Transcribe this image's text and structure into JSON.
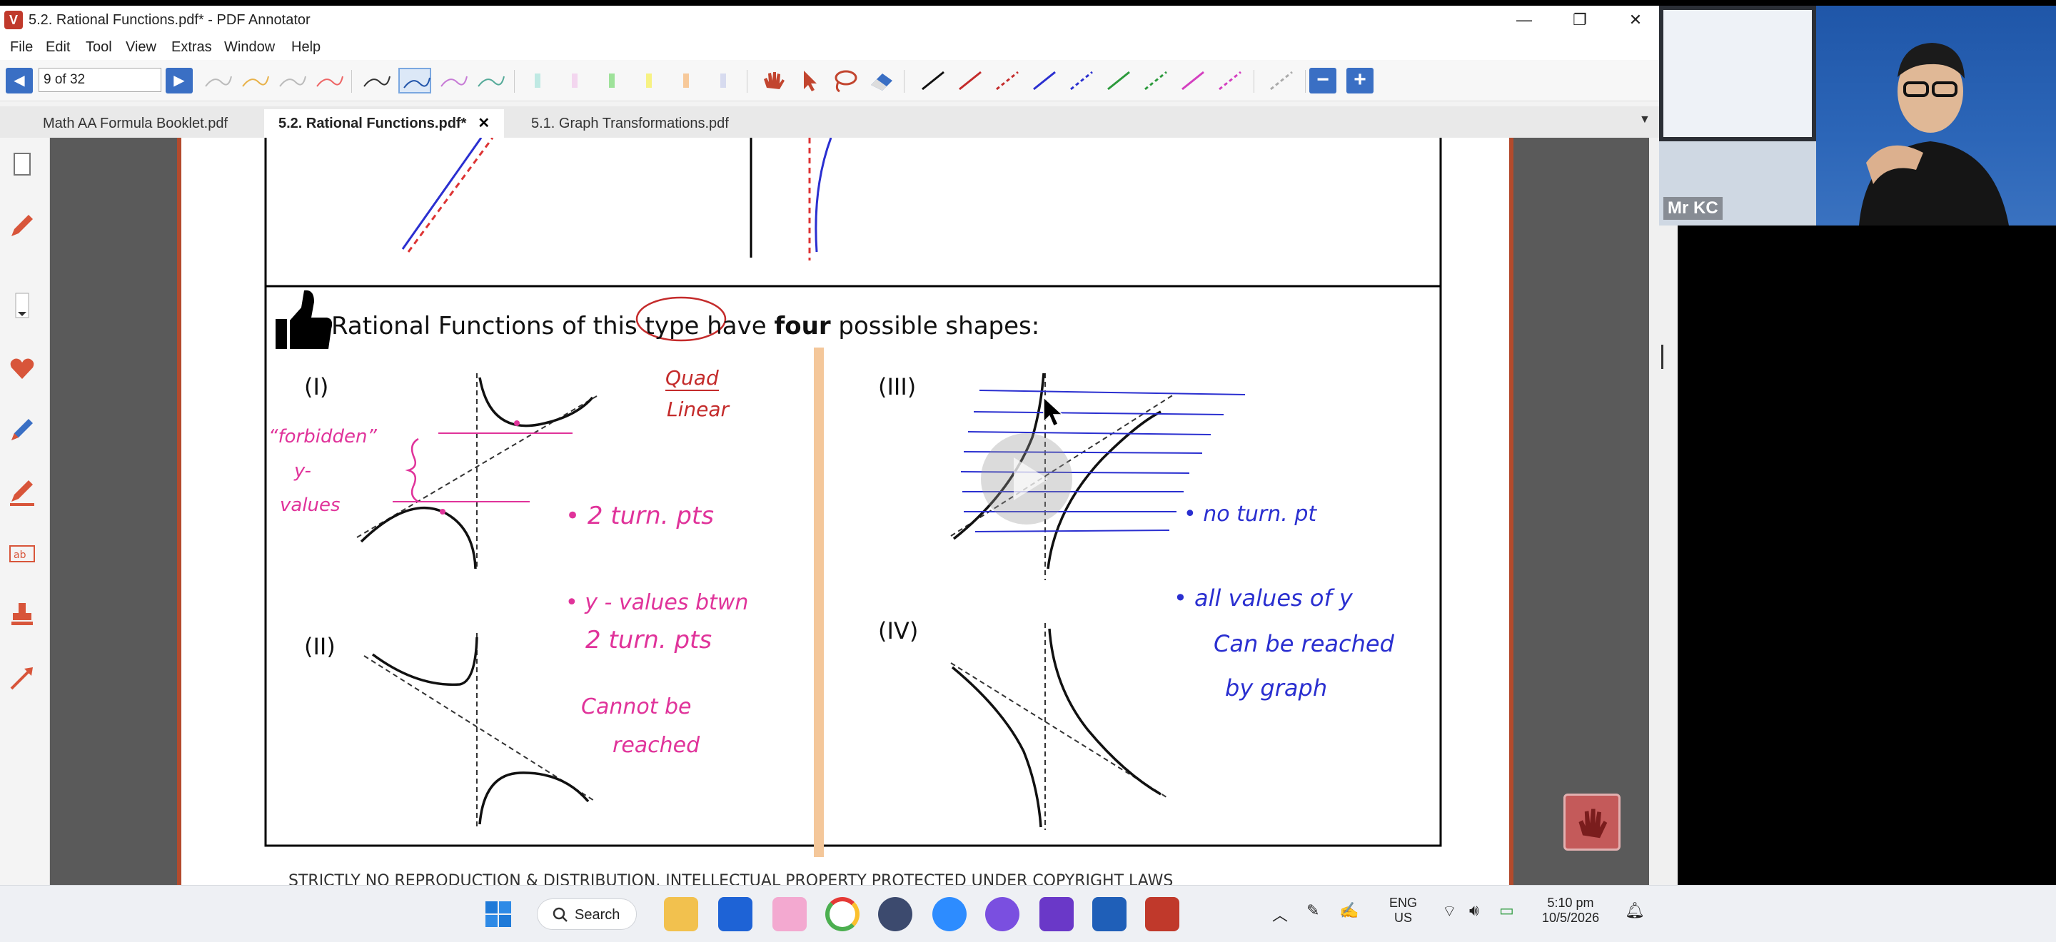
{
  "window": {
    "title": "5.2. Rational Functions.pdf* - PDF Annotator",
    "app_icon": "pdf-annotator-icon"
  },
  "menu": [
    "File",
    "Edit",
    "Tool",
    "View",
    "Extras",
    "Window",
    "Help"
  ],
  "toolbar": {
    "page_indicator": "9 of 32",
    "zoom_out": "−",
    "zoom_in": "+"
  },
  "tabs": [
    {
      "label": "Math AA Formula Booklet.pdf",
      "active": false
    },
    {
      "label": "5.2. Rational Functions.pdf*",
      "active": true,
      "close": "✕"
    },
    {
      "label": "5.1. Graph Transformations.pdf",
      "active": false
    }
  ],
  "document": {
    "heading_pre": "Rational Functions of this type have ",
    "heading_bold": "four",
    "heading_post": " possible shapes:",
    "labels": {
      "i": "(I)",
      "ii": "(II)",
      "iii": "(III)",
      "iv": "(IV)"
    },
    "footer": "STRICTLY NO REPRODUCTION & DISTRIBUTION. INTELLECTUAL PROPERTY PROTECTED UNDER COPYRIGHT LAWS"
  },
  "handwriting": {
    "quad": "Quad",
    "linear": "Linear",
    "forbidden_1": "“forbidden”",
    "forbidden_2": "y-",
    "forbidden_3": "values",
    "two_turn": "• 2  turn.  pts",
    "yvalues_1": "• y - values  btwn",
    "yvalues_2": "2  turn.  pts",
    "yvalues_3": "Cannot  be",
    "yvalues_4": "reached",
    "no_turn": "• no  turn.  pt",
    "all_1": "• all  values  of  y",
    "all_2": "Can  be  reached",
    "all_3": "by  graph"
  },
  "video": {
    "name": "Mr KC"
  },
  "taskbar": {
    "search": "Search",
    "lang_1": "ENG",
    "lang_2": "US",
    "time": "5:10 pm",
    "date": "10/5/2026"
  },
  "colors": {
    "accent": "#3a6fc4",
    "pen_magenta": "#e0339a",
    "pen_blue": "#2a2fd0",
    "pen_red": "#c42b2b",
    "highlighter": "#f4c79a"
  }
}
